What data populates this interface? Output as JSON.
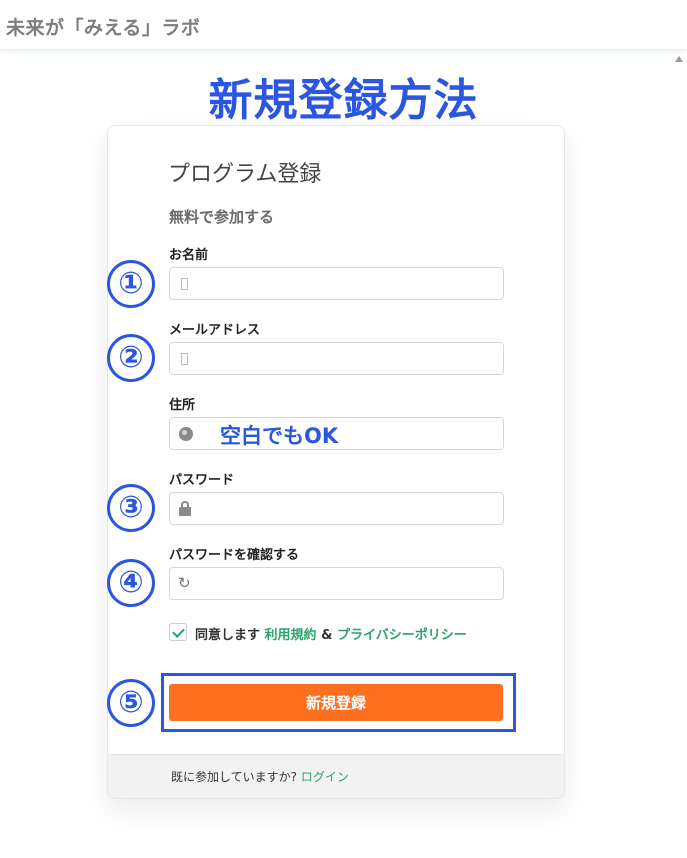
{
  "header": {
    "site_title": "未来が「みえる」ラボ"
  },
  "page": {
    "heading": "新規登録方法"
  },
  "form": {
    "title": "プログラム登録",
    "subtitle": "無料で参加する",
    "fields": [
      {
        "label": "お名前",
        "value": "",
        "placeholder": "",
        "icon": "user-icon"
      },
      {
        "label": "メールアドレス",
        "value": "",
        "placeholder": "",
        "icon": "envelope-icon"
      },
      {
        "label": "住所",
        "value": "",
        "placeholder": "",
        "icon": "globe-icon"
      },
      {
        "label": "パスワード",
        "value": "",
        "placeholder": "",
        "icon": "lock-icon"
      },
      {
        "label": "パスワードを確認する",
        "value": "",
        "placeholder": "",
        "icon": "refresh-icon"
      }
    ],
    "agree": {
      "checked": true,
      "prefix": "同意します",
      "terms_link": "利用規約",
      "amp": "&",
      "privacy_link": "プライバシーポリシー"
    },
    "submit_label": "新規登録",
    "footer": {
      "text": "既に参加していますか?",
      "login_link": "ログイン"
    }
  },
  "annotations": {
    "address_note": "空白でもOK",
    "step_numbers": [
      "①",
      "②",
      "③",
      "④",
      "⑤"
    ]
  },
  "colors": {
    "accent_blue": "#2b56e0",
    "button_orange": "#fe6f20",
    "link_green": "#28a46b"
  }
}
